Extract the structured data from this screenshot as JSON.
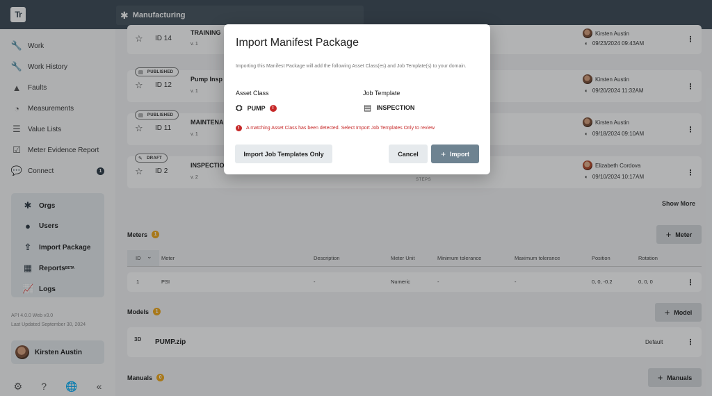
{
  "topbar": {
    "logo": "Tr",
    "org_name": "Manufacturing"
  },
  "sidebar": {
    "nav": [
      {
        "label": "Work",
        "icon": "wrench-icon"
      },
      {
        "label": "Work History",
        "icon": "wrench-icon"
      },
      {
        "label": "Faults",
        "icon": "warning-icon"
      },
      {
        "label": "Measurements",
        "icon": "gauge-icon"
      },
      {
        "label": "Value Lists",
        "icon": "list-icon"
      },
      {
        "label": "Meter Evidence Report",
        "icon": "checkbox-icon"
      },
      {
        "label": "Connect",
        "icon": "chat-icon",
        "badge": "1"
      }
    ],
    "admin": [
      {
        "label": "Orgs",
        "icon": "asterisk-icon"
      },
      {
        "label": "Users",
        "icon": "user-icon"
      },
      {
        "label": "Import Package",
        "icon": "upload-icon"
      },
      {
        "label": "Reports",
        "icon": "report-icon",
        "sup": "BETA"
      },
      {
        "label": "Logs",
        "icon": "chart-icon"
      }
    ],
    "api_version": "API 4.0.0 Web v3.0",
    "last_updated": "Last Updated September 30, 2024",
    "user_name": "Kirsten Austin"
  },
  "workflows": [
    {
      "status": "",
      "id": "ID 14",
      "title": "TRAINING",
      "version": "v. 1",
      "user": "Kirsten Austin",
      "date": "09/23/2024 09:43AM"
    },
    {
      "status": "PUBLISHED",
      "id": "ID 12",
      "title": "Pump Insp",
      "version": "v. 1",
      "user": "Kirsten Austin",
      "date": "09/20/2024 11:32AM"
    },
    {
      "status": "PUBLISHED",
      "id": "ID 11",
      "title": "MAINTENA",
      "version": "v. 1",
      "user": "Kirsten Austin",
      "date": "09/18/2024 09:10AM"
    },
    {
      "status": "DRAFT",
      "id": "ID 2",
      "title": "INSPECTIO",
      "version": "v. 2",
      "user": "Elizabeth Cordova",
      "date": "09/10/2024 10:17AM",
      "steps": "STEPS"
    }
  ],
  "show_more": "Show More",
  "meters": {
    "title": "Meters",
    "count": "1",
    "add_label": "Meter",
    "columns": [
      "ID",
      "Meter",
      "Description",
      "Meter Unit",
      "Minimum tolerance",
      "Maximum tolerance",
      "Position",
      "Rotation"
    ],
    "row": {
      "id": "1",
      "meter": "PSI",
      "description": "-",
      "unit": "Numeric",
      "min": "-",
      "max": "-",
      "position": "0, 0, -0.2",
      "rotation": "0, 0, 0"
    }
  },
  "models": {
    "title": "Models",
    "count": "1",
    "add_label": "Model",
    "file_icon": "3D",
    "file": "PUMP.zip",
    "status": "Default"
  },
  "manuals": {
    "title": "Manuals",
    "count": "0",
    "add_label": "Manuals"
  },
  "modal": {
    "title": "Import Manifest Package",
    "description": "Importing this Manifest Package will add the following Asset Class(es) and Job Template(s) to your domain.",
    "asset_class_header": "Asset Class",
    "asset_class": "PUMP",
    "job_template_header": "Job Template",
    "job_template": "INSPECTION",
    "warning": "A matching Asset Class has been detected. Select Import Job Templates Only to review",
    "import_templates_only": "Import Job Templates Only",
    "cancel": "Cancel",
    "import": "Import",
    "error_color": "#c62828"
  }
}
